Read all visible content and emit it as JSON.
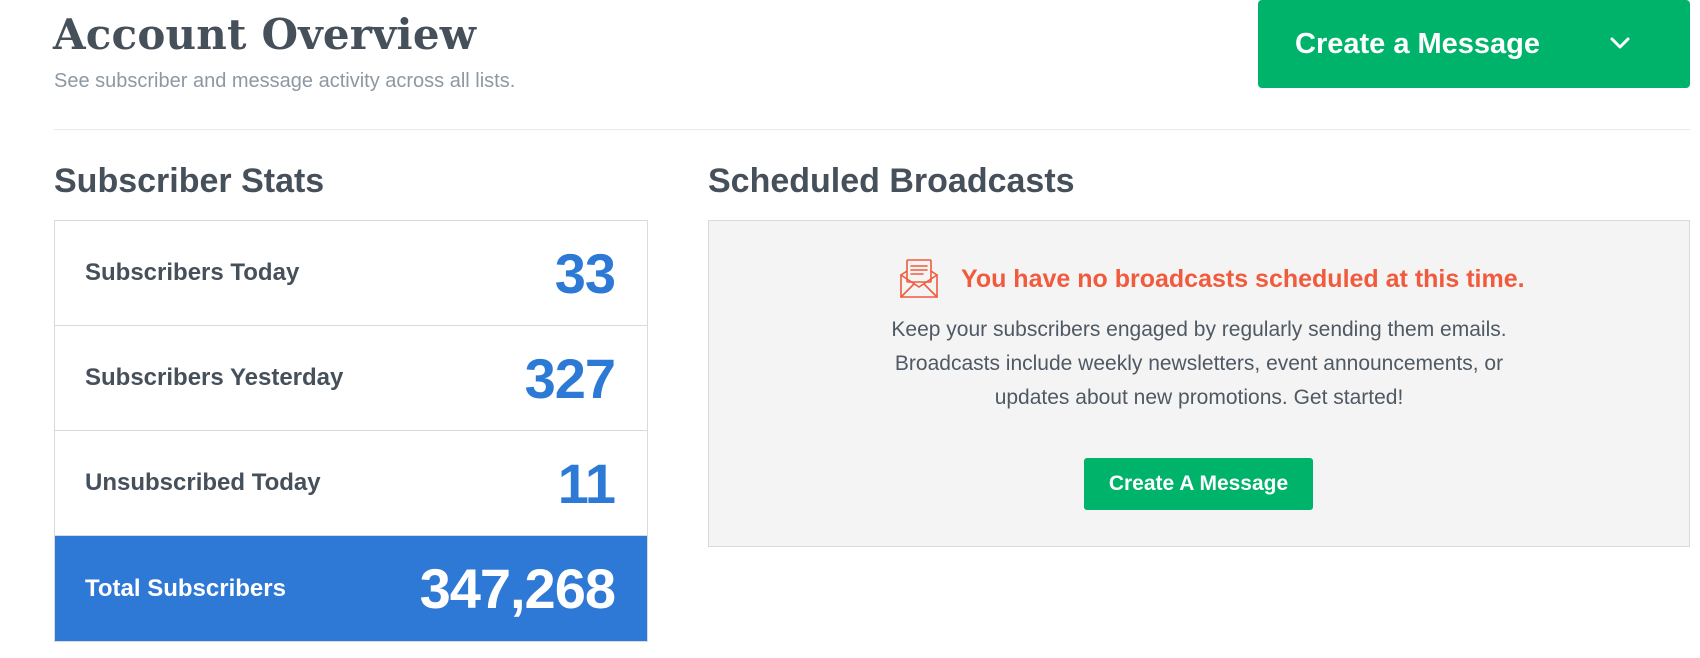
{
  "header": {
    "title": "Account Overview",
    "subtitle": "See subscriber and message activity across all lists.",
    "create_button_label": "Create a Message",
    "create_button_icon": "chevron-down-icon"
  },
  "subscriber_stats": {
    "title": "Subscriber Stats",
    "rows": [
      {
        "label": "Subscribers Today",
        "value": "33"
      },
      {
        "label": "Subscribers Yesterday",
        "value": "327"
      },
      {
        "label": "Unsubscribed Today",
        "value": "11"
      }
    ],
    "total": {
      "label": "Total Subscribers",
      "value": "347,268"
    }
  },
  "scheduled_broadcasts": {
    "title": "Scheduled Broadcasts",
    "empty_icon": "envelope-newsletter-icon",
    "empty_title": "You have no broadcasts scheduled at this time.",
    "empty_lines": [
      "Keep your subscribers engaged by regularly sending them emails.",
      "Broadcasts include weekly newsletters, event announcements, or",
      "updates about new promotions. Get started!"
    ],
    "button_label": "Create A Message"
  },
  "colors": {
    "brand_green": "#00b36b",
    "stat_blue": "#2d7ad6",
    "total_row_blue": "#2e78d6",
    "alert_orange": "#f15a3c",
    "panel_gray": "#f4f4f4"
  }
}
